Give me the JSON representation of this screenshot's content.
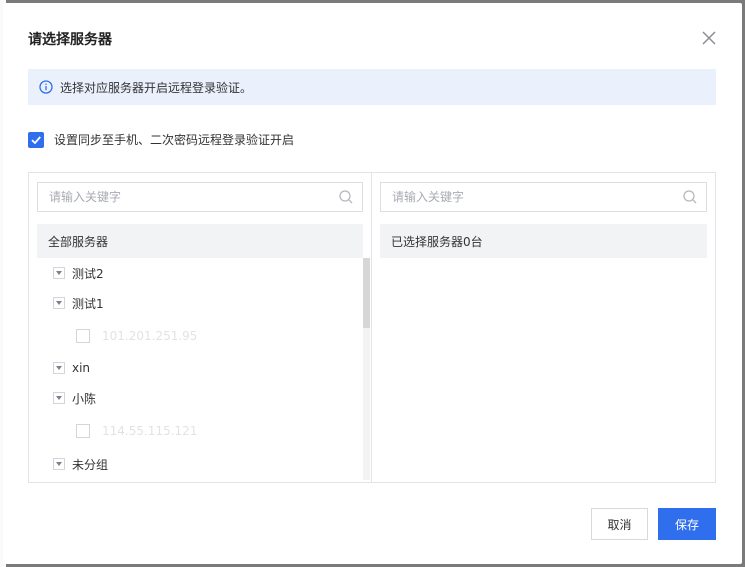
{
  "dialog": {
    "title": "请选择服务器",
    "info_text": "选择对应服务器开启远程登录验证。",
    "sync_option": {
      "label": "设置同步至手机、二次密码远程登录验证开启",
      "checked": true
    },
    "left_panel": {
      "search_placeholder": "请输入关键字",
      "header": "全部服务器",
      "groups": [
        {
          "label": "测试2",
          "expanded": false,
          "servers": []
        },
        {
          "label": "测试1",
          "expanded": true,
          "servers": [
            {
              "ip": "101.201.251.95",
              "checked": false
            }
          ]
        },
        {
          "label": "xin",
          "expanded": false,
          "servers": []
        },
        {
          "label": "小陈",
          "expanded": true,
          "servers": [
            {
              "ip": "114.55.115.121",
              "checked": false
            }
          ]
        },
        {
          "label": "未分组",
          "expanded": false,
          "servers": []
        }
      ]
    },
    "right_panel": {
      "search_placeholder": "请输入关键字",
      "header": "已选择服务器0台"
    },
    "buttons": {
      "cancel": "取消",
      "save": "保存"
    }
  },
  "colors": {
    "primary": "#2f6fee",
    "info_bg": "#eaf1fd",
    "overlay": "#7a7a7a"
  }
}
